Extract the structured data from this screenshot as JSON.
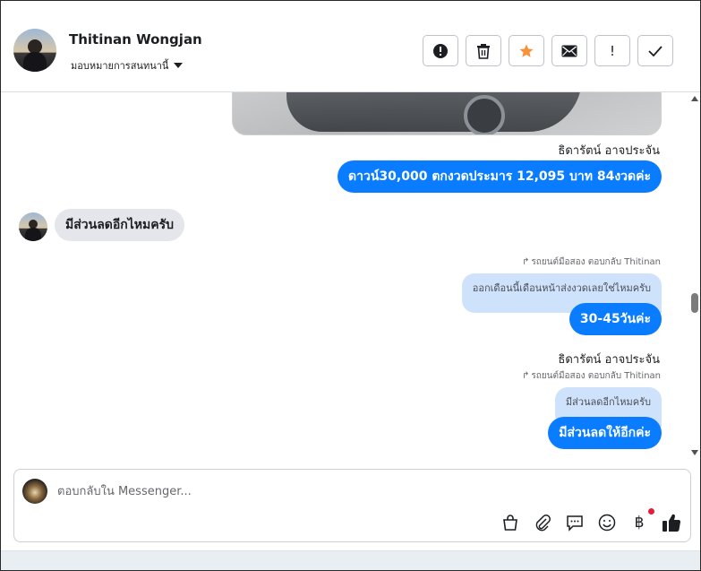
{
  "header": {
    "contact_name": "Thitinan Wongjan",
    "assign_label": "มอบหมายการสนทนานี้",
    "actions": [
      {
        "name": "mark-spam",
        "icon": "alert-circle-icon"
      },
      {
        "name": "delete",
        "icon": "trash-icon"
      },
      {
        "name": "star",
        "icon": "star-icon",
        "color": "#f7923a"
      },
      {
        "name": "mark-unread",
        "icon": "envelope-icon"
      },
      {
        "name": "follow-up",
        "icon": "exclamation-icon",
        "glyph": "!"
      },
      {
        "name": "mark-done",
        "icon": "check-icon"
      }
    ]
  },
  "messages": {
    "sender_name_1": "ธิดารัตน์ อาจประจัน",
    "msg_out_1": "ดาวน์30,000 ตกงวดประมาร 12,095 บาท 84งวดค่ะ",
    "msg_in_1": "มีส่วนลดอีกไหมครับ",
    "reply_note_1": "รถยนต์มือสอง ตอบกลับ Thitinan",
    "quoted_1": "ออกเดือนนี้เดือนหน้าส่งงวดเลยใช่ไหมครับ",
    "msg_out_2": "30-45วันค่ะ",
    "sender_name_2": "ธิดารัตน์ อาจประจัน",
    "reply_note_2": "รถยนต์มือสอง ตอบกลับ Thitinan",
    "quoted_2": "มีส่วนลดอีกไหมครับ",
    "msg_out_3": "มีส่วนลดให้อีกค่ะ"
  },
  "composer": {
    "placeholder": "ตอบกลับใน Messenger...",
    "tools": [
      "bag-icon",
      "paperclip-icon",
      "saved-replies-icon",
      "emoji-icon",
      "baht-icon",
      "thumbs-up-icon"
    ]
  },
  "colors": {
    "outgoing_bubble": "#0a7cff",
    "incoming_bubble": "#e4e6eb",
    "quoted_bubble": "#cfe2fb",
    "star": "#f7923a"
  }
}
